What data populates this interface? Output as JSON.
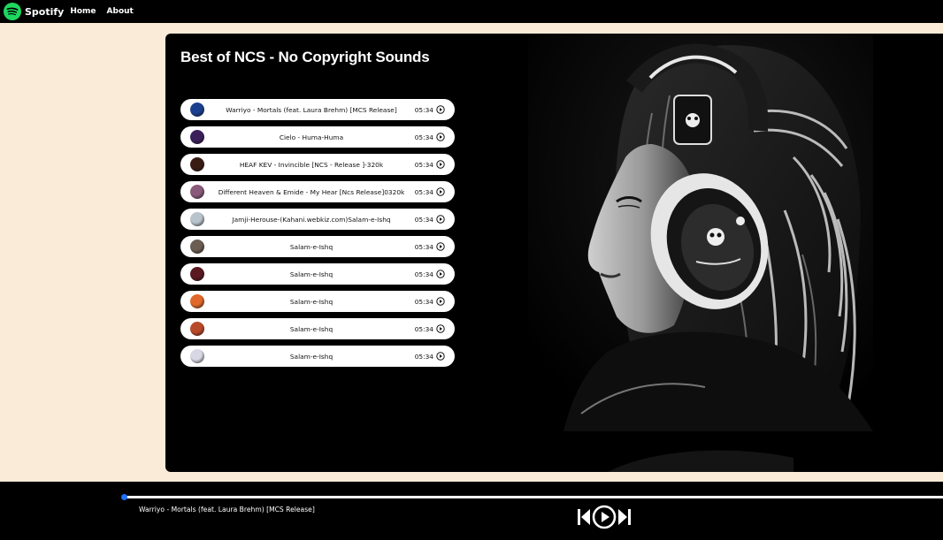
{
  "nav": {
    "brand": "Spotify",
    "links": [
      "Home",
      "About"
    ]
  },
  "playlist": {
    "title": "Best of NCS - No Copyright Sounds",
    "songs": [
      {
        "name": "Warriyo - Mortals (feat. Laura Brehm) [MCS Release]",
        "duration": "05:34",
        "thumb_color": "#1b3f8f"
      },
      {
        "name": "Cielo - Huma-Huma",
        "duration": "05:34",
        "thumb_color": "#3b1f5a"
      },
      {
        "name": "HEAF KEV - Invincible [NCS - Release ]-320k",
        "duration": "05:34",
        "thumb_color": "#3a1b14"
      },
      {
        "name": "Different Heaven & Emide - My Hear [Ncs Release]0320k",
        "duration": "05:34",
        "thumb_color": "#8a5a7a"
      },
      {
        "name": "Jamji-Herouse-(Kahani.webkiz.com)Salam-e-Ishq",
        "duration": "05:34",
        "thumb_color": "#b9c3cc"
      },
      {
        "name": "Salam-e-Ishq",
        "duration": "05:34",
        "thumb_color": "#6b5d52"
      },
      {
        "name": "Salam-e-Ishq",
        "duration": "05:34",
        "thumb_color": "#5a1820"
      },
      {
        "name": "Salam-e-Ishq",
        "duration": "05:34",
        "thumb_color": "#e0682a"
      },
      {
        "name": "Salam-e-Ishq",
        "duration": "05:34",
        "thumb_color": "#b84a2a"
      },
      {
        "name": "Salam-e-Ishq",
        "duration": "05:34",
        "thumb_color": "#d8d8e4"
      }
    ]
  },
  "player": {
    "now_playing": "Warriyo - Mortals (feat. Laura Brehm) [MCS Release]",
    "progress": 0
  },
  "colors": {
    "brand_green": "#1ed760",
    "page_bg": "#f9ebd8",
    "progress_dot": "#1e6fff"
  },
  "icons": {
    "brand": "spotify-logo-icon",
    "song_play": "play-circle-icon",
    "previous": "skip-previous-icon",
    "play": "play-circle-icon",
    "next": "skip-next-icon"
  }
}
